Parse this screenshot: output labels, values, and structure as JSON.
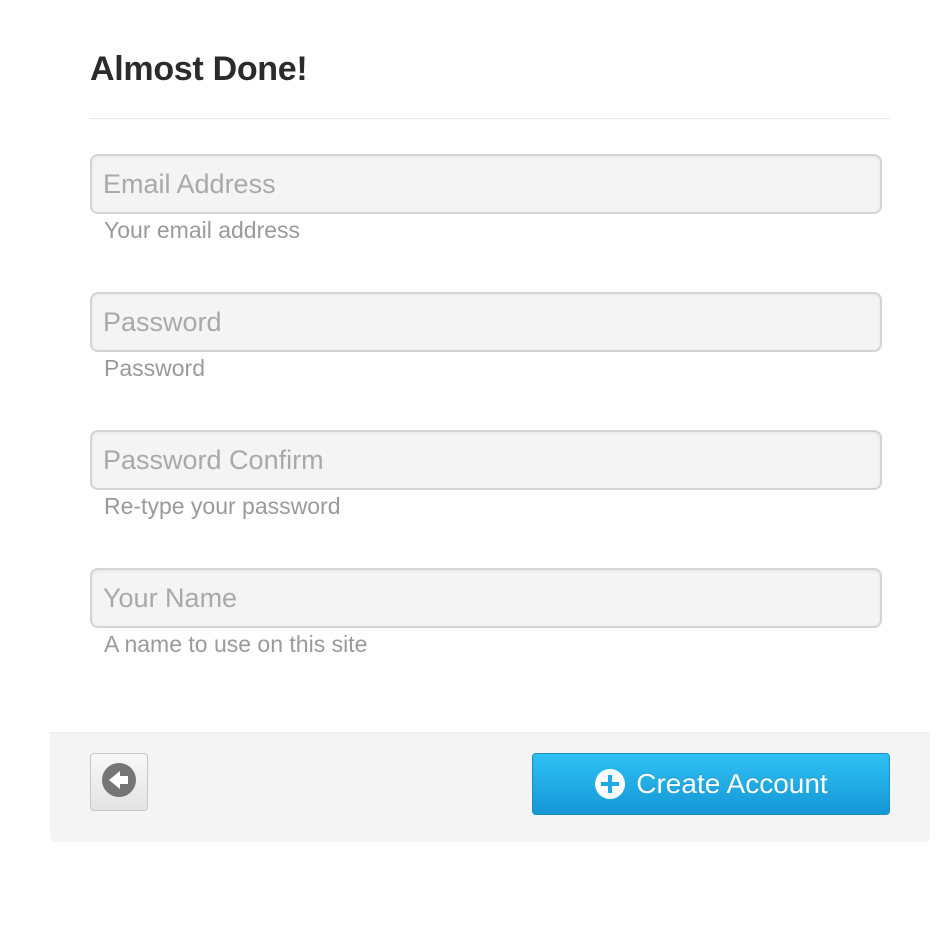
{
  "header": {
    "title": "Almost Done!"
  },
  "form": {
    "email": {
      "placeholder": "Email Address",
      "value": "",
      "help": "Your email address"
    },
    "password": {
      "placeholder": "Password",
      "value": "",
      "help": "Password"
    },
    "password_confirm": {
      "placeholder": "Password Confirm",
      "value": "",
      "help": "Re-type your password"
    },
    "name": {
      "placeholder": "Your Name",
      "value": "",
      "help": "A name to use on this site"
    }
  },
  "footer": {
    "back_icon": "arrow-left-circle-icon",
    "create_icon": "plus-circle-icon",
    "create_label": "Create Account"
  },
  "colors": {
    "primary_button": "#1fa9e6",
    "input_background": "#f4f4f4",
    "title_text": "#2b2b2b",
    "help_text": "#9a9a9a"
  }
}
